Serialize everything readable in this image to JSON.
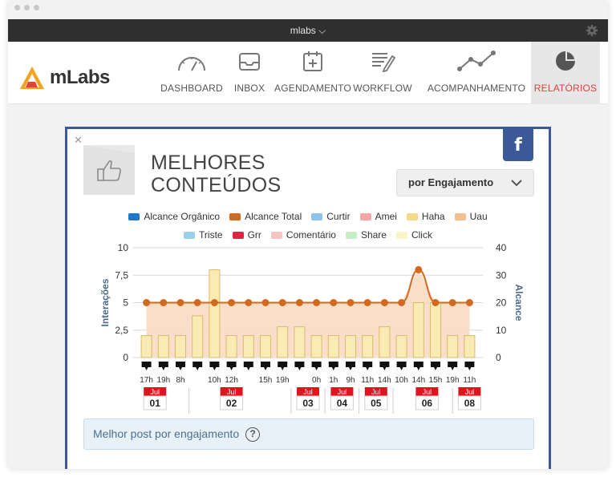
{
  "window": {
    "title": "mlabs"
  },
  "brand": {
    "name": "mLabs"
  },
  "nav": {
    "items": [
      {
        "label": "DASHBOARD",
        "icon": "gauge-icon"
      },
      {
        "label": "INBOX",
        "icon": "inbox-icon"
      },
      {
        "label": "AGENDAMENTO",
        "icon": "calendar-icon"
      },
      {
        "label": "WORKFLOW",
        "icon": "checklist-icon"
      },
      {
        "label": "ACOMPANHAMENTO",
        "icon": "line-trend-icon"
      },
      {
        "label": "RELATÓRIOS",
        "icon": "pie-chart-icon",
        "active": true
      }
    ]
  },
  "card": {
    "title_line1": "MELHORES",
    "title_line2": "CONTEÚDOS",
    "network_badge": "f",
    "sort_label": "por Engajamento",
    "best_post_label": "Melhor post por engajamento",
    "help_glyph": "?"
  },
  "chart_data": {
    "type": "bar",
    "legend_row1": [
      {
        "name": "Alcance Orgânico",
        "color": "#1f78c8"
      },
      {
        "name": "Alcance Total",
        "color": "#d2691e"
      },
      {
        "name": "Curtir",
        "color": "#8fc3ea"
      },
      {
        "name": "Amei",
        "color": "#f4a6a6"
      },
      {
        "name": "Haha",
        "color": "#f6d98a"
      },
      {
        "name": "Uau",
        "color": "#f2c08f"
      }
    ],
    "legend_row2": [
      {
        "name": "Triste",
        "color": "#9fd0ea"
      },
      {
        "name": "Grr",
        "color": "#e02545"
      },
      {
        "name": "Comentário",
        "color": "#f5c5c5"
      },
      {
        "name": "Share",
        "color": "#c7efc7"
      },
      {
        "name": "Click",
        "color": "#fbf5c8"
      }
    ],
    "ylabel_left": "Interações",
    "ylabel_right": "Alcance",
    "ylim_left": [
      0,
      10
    ],
    "ylim_right": [
      0,
      40
    ],
    "yticks_left": [
      "0",
      "2,5",
      "5",
      "7,5",
      "10"
    ],
    "yticks_right": [
      "0",
      "10",
      "20",
      "30",
      "40"
    ],
    "x": [
      "17h",
      "19h",
      "8h",
      "10h",
      "12h",
      "15h",
      "19h",
      "0h",
      "1h",
      "9h",
      "11h",
      "14h",
      "10h",
      "14h",
      "15h",
      "19h",
      "11h"
    ],
    "interactions": [
      2,
      2,
      2,
      3.8,
      8,
      2,
      2,
      2,
      2.8,
      2.8,
      2,
      2,
      2,
      2,
      2.8,
      2,
      5,
      5,
      2,
      2
    ],
    "bar_columns": 20,
    "alcance_total": [
      20,
      20,
      20,
      20,
      20,
      20,
      20,
      20,
      20,
      20,
      20,
      20,
      20,
      20,
      20,
      20,
      32,
      20,
      20,
      20
    ],
    "date_groups": [
      {
        "month": "Jul",
        "day": "01"
      },
      {
        "month": "Jul",
        "day": "02"
      },
      {
        "month": "Jul",
        "day": "03"
      },
      {
        "month": "Jul",
        "day": "04"
      },
      {
        "month": "Jul",
        "day": "05"
      },
      {
        "month": "Jul",
        "day": "06"
      },
      {
        "month": "Jul",
        "day": "08"
      }
    ],
    "bar_color": "#faebb5",
    "bar_stroke": "#d9b96a",
    "area_color": "#f8dcc3",
    "line_color": "#d2691e"
  }
}
